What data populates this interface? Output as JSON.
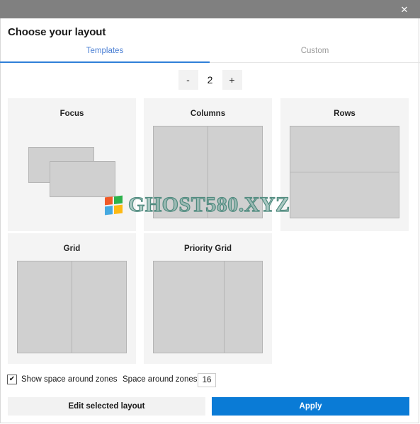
{
  "window": {
    "close_icon": "close-icon",
    "close_glyph": "✕",
    "titlebar_color": "#808080"
  },
  "header": {
    "title": "Choose your layout"
  },
  "tabs": [
    {
      "label": "Templates",
      "active": true
    },
    {
      "label": "Custom",
      "active": false
    }
  ],
  "counter": {
    "decrement_label": "-",
    "value": "2",
    "increment_label": "+"
  },
  "templates": [
    {
      "name": "Focus",
      "kind": "focus",
      "zones": 2
    },
    {
      "name": "Columns",
      "kind": "columns",
      "zones": 2
    },
    {
      "name": "Rows",
      "kind": "rows",
      "zones": 2
    },
    {
      "name": "Grid",
      "kind": "grid",
      "zones": 2
    },
    {
      "name": "Priority Grid",
      "kind": "priority-grid",
      "zones": 2
    }
  ],
  "options": {
    "show_space_checkbox_label": "Show space around zones",
    "show_space_checked": true,
    "check_glyph": "✔",
    "space_label": "Space around zones",
    "space_value": "16"
  },
  "actions": {
    "edit_label": "Edit selected layout",
    "apply_label": "Apply",
    "apply_color": "#0a7bd6"
  },
  "watermark": {
    "text": "GHOST580.XYZ",
    "logo": "windows-logo",
    "colors": {
      "top_left": "#f05a28",
      "top_right": "#2eb24c",
      "bottom_left": "#45a9e0",
      "bottom_right": "#fdb913"
    }
  }
}
